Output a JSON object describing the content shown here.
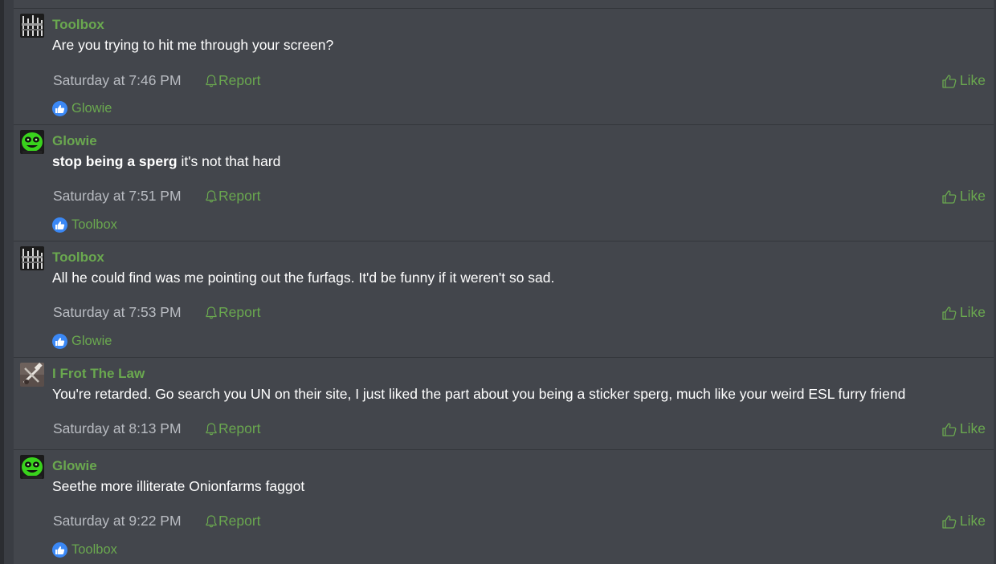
{
  "colors": {
    "page_bg": "#373a40",
    "post_bg": "#43464c",
    "link_green": "#6aa84f",
    "meta_gray": "#b9bcc2",
    "text_white": "#ffffff",
    "like_blue": "#3b88f5"
  },
  "posts": [
    {
      "username": "Toolbox",
      "avatar_icon": "toolbox-avatar",
      "message_bold": "",
      "message": "Are you trying to hit me through your screen?",
      "timestamp": "Saturday at 7:46 PM",
      "report_label": "Report",
      "like_label": "Like",
      "reacted_by": "Glowie"
    },
    {
      "username": "Glowie",
      "avatar_icon": "glowie-avatar",
      "message_bold": "stop being a sperg",
      "message": " it's not that hard",
      "timestamp": "Saturday at 7:51 PM",
      "report_label": "Report",
      "like_label": "Like",
      "reacted_by": "Toolbox"
    },
    {
      "username": "Toolbox",
      "avatar_icon": "toolbox-avatar",
      "message_bold": "",
      "message": "All he could find was me pointing out the furfags. It'd be funny if it weren't so sad.",
      "timestamp": "Saturday at 7:53 PM",
      "report_label": "Report",
      "like_label": "Like",
      "reacted_by": "Glowie"
    },
    {
      "username": "I Frot The Law",
      "avatar_icon": "frot-avatar",
      "message_bold": "",
      "message": "You're retarded. Go search you UN on their site, I just liked the part about you being a sticker sperg, much like your weird ESL furry friend",
      "timestamp": "Saturday at 8:13 PM",
      "report_label": "Report",
      "like_label": "Like",
      "reacted_by": ""
    },
    {
      "username": "Glowie",
      "avatar_icon": "glowie-avatar",
      "message_bold": "",
      "message": "Seethe more illiterate Onionfarms faggot",
      "timestamp": "Saturday at 9:22 PM",
      "report_label": "Report",
      "like_label": "Like",
      "reacted_by": "Toolbox"
    }
  ]
}
